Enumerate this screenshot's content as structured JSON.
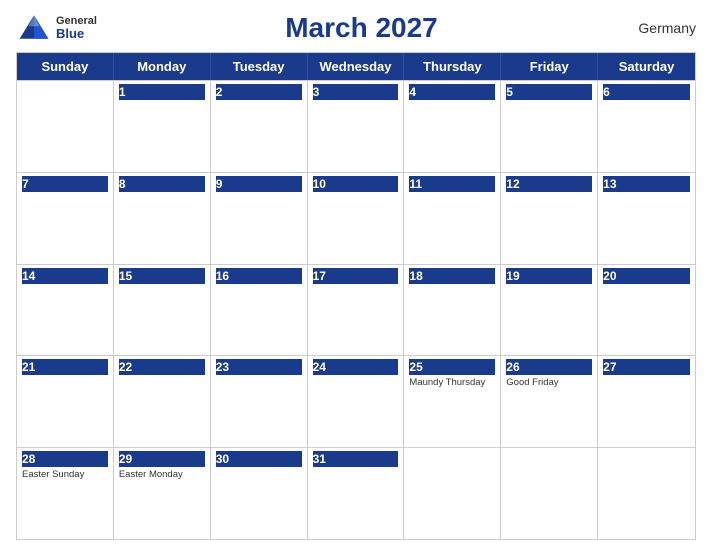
{
  "header": {
    "title": "March 2027",
    "country": "Germany",
    "logo": {
      "general": "General",
      "blue": "Blue"
    }
  },
  "weekdays": [
    "Sunday",
    "Monday",
    "Tuesday",
    "Wednesday",
    "Thursday",
    "Friday",
    "Saturday"
  ],
  "weeks": [
    [
      {
        "day": "",
        "holiday": ""
      },
      {
        "day": "1",
        "holiday": ""
      },
      {
        "day": "2",
        "holiday": ""
      },
      {
        "day": "3",
        "holiday": ""
      },
      {
        "day": "4",
        "holiday": ""
      },
      {
        "day": "5",
        "holiday": ""
      },
      {
        "day": "6",
        "holiday": ""
      }
    ],
    [
      {
        "day": "7",
        "holiday": ""
      },
      {
        "day": "8",
        "holiday": ""
      },
      {
        "day": "9",
        "holiday": ""
      },
      {
        "day": "10",
        "holiday": ""
      },
      {
        "day": "11",
        "holiday": ""
      },
      {
        "day": "12",
        "holiday": ""
      },
      {
        "day": "13",
        "holiday": ""
      }
    ],
    [
      {
        "day": "14",
        "holiday": ""
      },
      {
        "day": "15",
        "holiday": ""
      },
      {
        "day": "16",
        "holiday": ""
      },
      {
        "day": "17",
        "holiday": ""
      },
      {
        "day": "18",
        "holiday": ""
      },
      {
        "day": "19",
        "holiday": ""
      },
      {
        "day": "20",
        "holiday": ""
      }
    ],
    [
      {
        "day": "21",
        "holiday": ""
      },
      {
        "day": "22",
        "holiday": ""
      },
      {
        "day": "23",
        "holiday": ""
      },
      {
        "day": "24",
        "holiday": ""
      },
      {
        "day": "25",
        "holiday": "Maundy Thursday"
      },
      {
        "day": "26",
        "holiday": "Good Friday"
      },
      {
        "day": "27",
        "holiday": ""
      }
    ],
    [
      {
        "day": "28",
        "holiday": "Easter Sunday"
      },
      {
        "day": "29",
        "holiday": "Easter Monday"
      },
      {
        "day": "30",
        "holiday": ""
      },
      {
        "day": "31",
        "holiday": ""
      },
      {
        "day": "",
        "holiday": ""
      },
      {
        "day": "",
        "holiday": ""
      },
      {
        "day": "",
        "holiday": ""
      }
    ]
  ]
}
